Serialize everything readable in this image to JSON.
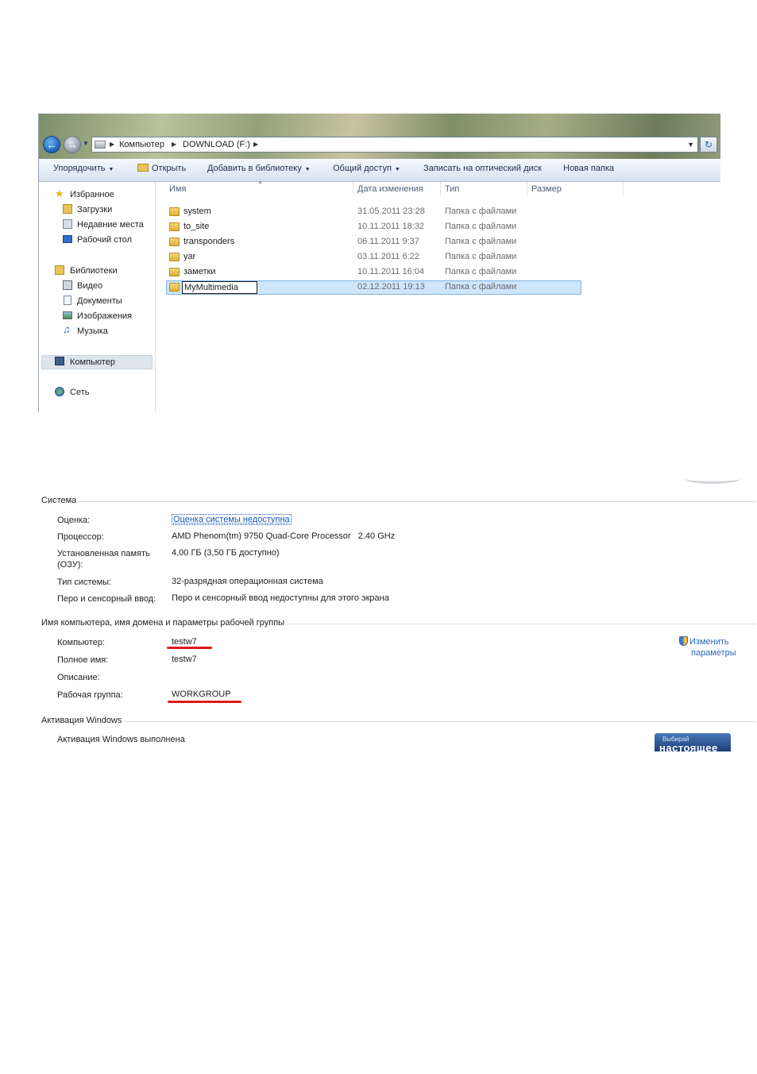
{
  "explorer": {
    "address": {
      "segments": [
        "Компьютер",
        "DOWNLOAD (F:)"
      ]
    },
    "toolbar": {
      "organize": "Упорядочить",
      "open": "Открыть",
      "add_to_library": "Добавить в библиотеку",
      "share": "Общий доступ",
      "burn": "Записать на оптический диск",
      "new_folder": "Новая папка"
    },
    "nav": {
      "favorites": {
        "label": "Избранное",
        "items": [
          "Загрузки",
          "Недавние места",
          "Рабочий стол"
        ]
      },
      "libraries": {
        "label": "Библиотеки",
        "items": [
          "Видео",
          "Документы",
          "Изображения",
          "Музыка"
        ]
      },
      "computer": "Компьютер",
      "network": "Сеть"
    },
    "columns": {
      "name": "Имя",
      "date": "Дата изменения",
      "type": "Тип",
      "size": "Размер"
    },
    "files": [
      {
        "name": "system",
        "date": "31.05.2011 23:28",
        "type": "Папка с файлами"
      },
      {
        "name": "to_site",
        "date": "10.11.2011 18:32",
        "type": "Папка с файлами"
      },
      {
        "name": "transponders",
        "date": "06.11.2011 9:37",
        "type": "Папка с файлами"
      },
      {
        "name": "yar",
        "date": "03.11.2011 6:22",
        "type": "Папка с файлами"
      },
      {
        "name": "заметки",
        "date": "10.11.2011 16:04",
        "type": "Папка с файлами"
      },
      {
        "name": "MyMultimedia",
        "date": "02.12.2011 19:13",
        "type": "Папка с файлами"
      }
    ]
  },
  "system": {
    "section_system": "Система",
    "rating_label": "Оценка:",
    "rating_value": "Оценка системы недоступна",
    "cpu_label": "Процессор:",
    "cpu_value": "AMD Phenom(tm) 9750 Quad-Core Processor   2.40 GHz",
    "ram_label_1": "Установленная память",
    "ram_label_2": "(ОЗУ):",
    "ram_value": "4,00 ГБ (3,50 ГБ доступно)",
    "type_label": "Тип системы:",
    "type_value": "32-разрядная операционная система",
    "pen_label": "Перо и сенсорный ввод:",
    "pen_value": "Перо и сенсорный ввод недоступны для этого экрана",
    "section_name": "Имя компьютера, имя домена и параметры рабочей группы",
    "computer_label": "Компьютер:",
    "computer_value": "testw7",
    "fullname_label": "Полное имя:",
    "fullname_value": "testw7",
    "desc_label": "Описание:",
    "workgroup_label": "Рабочая группа:",
    "workgroup_value": "WORKGROUP",
    "change_link_1": "Изменить",
    "change_link_2": "параметры",
    "section_activation": "Активация Windows",
    "activation_value": "Активация Windows выполнена",
    "genuine_small": "Выбирай",
    "genuine_big": "настоящее"
  },
  "colors": {
    "link": "#1a56b0",
    "underline_red": "#e01818",
    "selection": "#cde6fb"
  }
}
